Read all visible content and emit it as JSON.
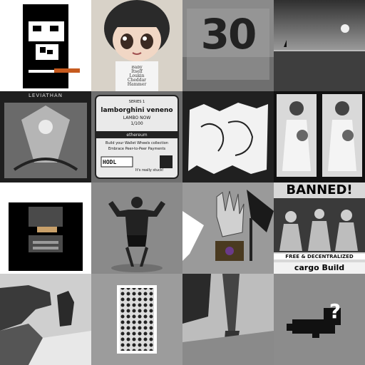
{
  "grid": {
    "rows": 4,
    "cols": 4,
    "tiles": [
      {
        "label": "pixel-skull-smoking",
        "icon": "pixel-skull-icon",
        "text": ""
      },
      {
        "label": "anime-girl-shirt",
        "icon": "anime-girl-icon",
        "text": "Baby\nItself\nLoukin\nCheddar\nHammer"
      },
      {
        "label": "graffiti-30",
        "icon": "graffiti-icon",
        "text": "30"
      },
      {
        "label": "sunset-sea",
        "icon": "sailboat-icon",
        "text": ""
      },
      {
        "label": "leviathan-card",
        "icon": "angel-icon",
        "text": "LEVIATHAN"
      },
      {
        "label": "lamborghini-ticket",
        "icon": "ticket-icon",
        "text": "lamborghini veneno",
        "lines": [
          "SERIES 1",
          "LAMBO NOW",
          "1/100",
          "ethereum",
          "Build your Wallet Wheels collection",
          "Embrace Peer-to-Peer Payments",
          "HODL",
          "It's really stuck!"
        ]
      },
      {
        "label": "doodle-sketch",
        "icon": "doodle-icon",
        "text": ""
      },
      {
        "label": "vintage-bride-photos",
        "icon": "bride-icon",
        "text": ""
      },
      {
        "label": "pixel-helmet",
        "icon": "pixel-helmet-icon",
        "text": ""
      },
      {
        "label": "bodybuilder-statue",
        "icon": "bodybuilder-icon",
        "text": ""
      },
      {
        "label": "robot-hand-trophy",
        "icon": "robot-hand-icon",
        "text": ""
      },
      {
        "label": "banned-poster",
        "icon": "poster-icon",
        "text": "BANNED!",
        "lines": [
          "FREE & DECENTRALIZED",
          "cargo Build"
        ]
      },
      {
        "label": "rocky-coast",
        "icon": "coast-icon",
        "text": ""
      },
      {
        "label": "patterned-card",
        "icon": "card-icon",
        "text": ""
      },
      {
        "label": "street-walker",
        "icon": "walker-icon",
        "text": ""
      },
      {
        "label": "pixel-question-bird",
        "icon": "question-bird-icon",
        "text": "?"
      }
    ]
  },
  "colors": {
    "white": "#ffffff",
    "black": "#000000",
    "gray_mid": "#888888",
    "cigar_orange": "#c65a1e",
    "helmet_tan": "#c8a06a",
    "purple_accent": "#6a3a8a"
  }
}
